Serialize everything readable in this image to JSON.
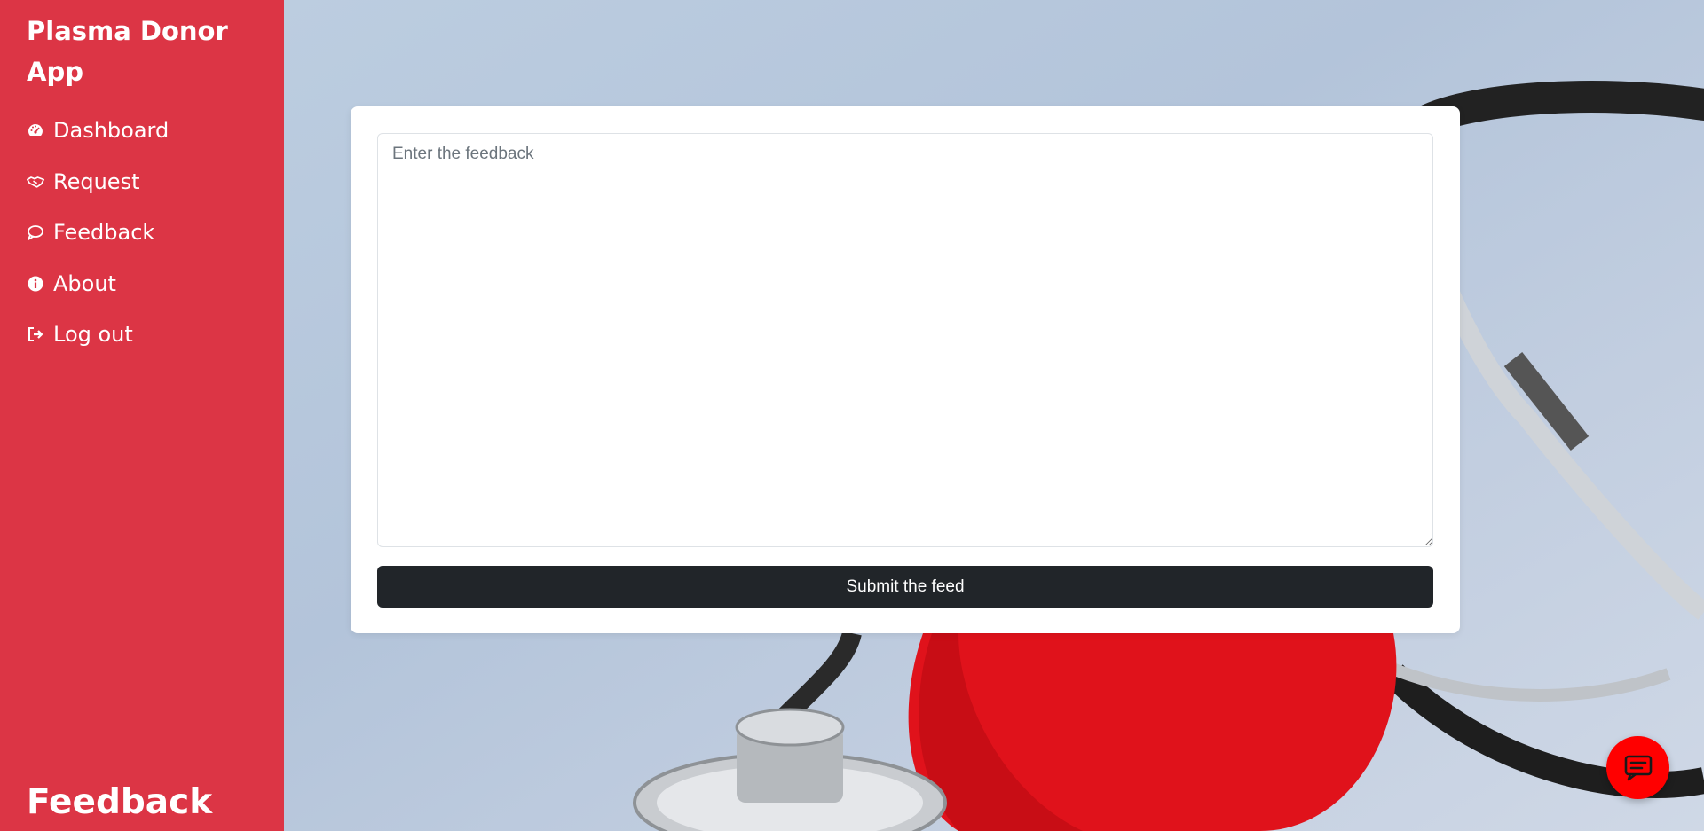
{
  "sidebar": {
    "brand": "Plasma Donor App",
    "items": [
      {
        "label": "Dashboard",
        "icon": "speedometer-icon"
      },
      {
        "label": "Request",
        "icon": "handshake-icon"
      },
      {
        "label": "Feedback",
        "icon": "chat-bubble-icon"
      },
      {
        "label": "About",
        "icon": "info-icon"
      },
      {
        "label": "Log out",
        "icon": "logout-icon"
      }
    ],
    "page_heading": "Feedback"
  },
  "form": {
    "placeholder": "Enter the feedback",
    "value": "",
    "submit_label": "Submit the feed"
  },
  "chat": {
    "icon": "chat-icon"
  },
  "colors": {
    "sidebar": "#dc3545",
    "button": "#212529",
    "chat_fab": "#ff0000"
  }
}
